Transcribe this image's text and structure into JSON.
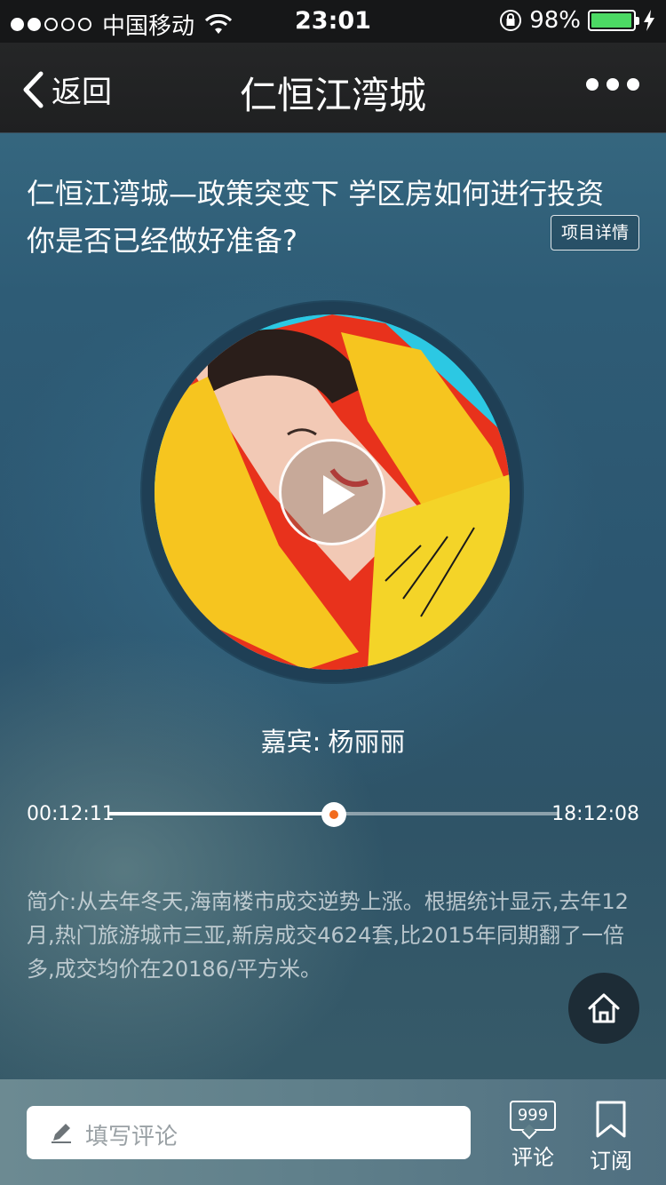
{
  "status_bar": {
    "carrier": "中国移动",
    "time": "23:01",
    "battery": "98%",
    "battery_level": 0.98
  },
  "nav": {
    "back_label": "返回",
    "title": "仁恒江湾城"
  },
  "article": {
    "headline": "仁恒江湾城—政策突变下 学区房如何进行投资 你是否已经做好准备?",
    "detail_button": "项目详情"
  },
  "player": {
    "guest_label": "嘉宾:",
    "guest_name": "杨丽丽",
    "current_time": "00:12:11",
    "total_time": "18:12:08",
    "progress": 0.5
  },
  "intro": {
    "text": "简介:从去年冬天,海南楼市成交逆势上涨。根据统计显示,去年12月,热门旅游城市三亚,新房成交4624套,比2015年同期翻了一倍多,成交均价在20186/平方米。"
  },
  "bottom_bar": {
    "comment_placeholder": "填写评论",
    "comment_count": "999",
    "comment_label": "评论",
    "subscribe_label": "订阅"
  },
  "colors": {
    "accent": "#f26b1d",
    "battery": "#4cd964"
  }
}
